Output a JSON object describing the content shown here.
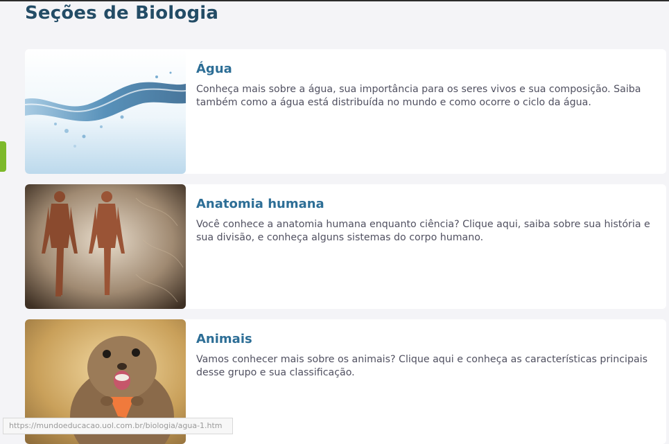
{
  "page": {
    "title": "Seções de Biologia"
  },
  "sections": [
    {
      "title": "Água",
      "description": "Conheça mais sobre a água, sua importância para os seres vivos e sua composição. Saiba também como a água está distribuída no mundo e como ocorre o ciclo da água.",
      "image": "water-splash-image"
    },
    {
      "title": "Anatomia humana",
      "description": "Você conhece a anatomia humana enquanto ciência? Clique aqui, saiba sobre sua história e sua divisão, e conheça alguns sistemas do corpo humano.",
      "image": "human-muscle-anatomy-image"
    },
    {
      "title": "Animais",
      "description": "Vamos conhecer mais sobre os animais? Clique aqui e conheça as características principais desse grupo e sua classificação.",
      "image": "ground-squirrel-image"
    }
  ],
  "status_bar": {
    "url": "https://mundoeducacao.uol.com.br/biologia/agua-1.htm"
  },
  "colors": {
    "title": "#234c66",
    "card_title": "#2d6e96",
    "accent_tab": "#7db92b",
    "background": "#f4f4f7"
  }
}
